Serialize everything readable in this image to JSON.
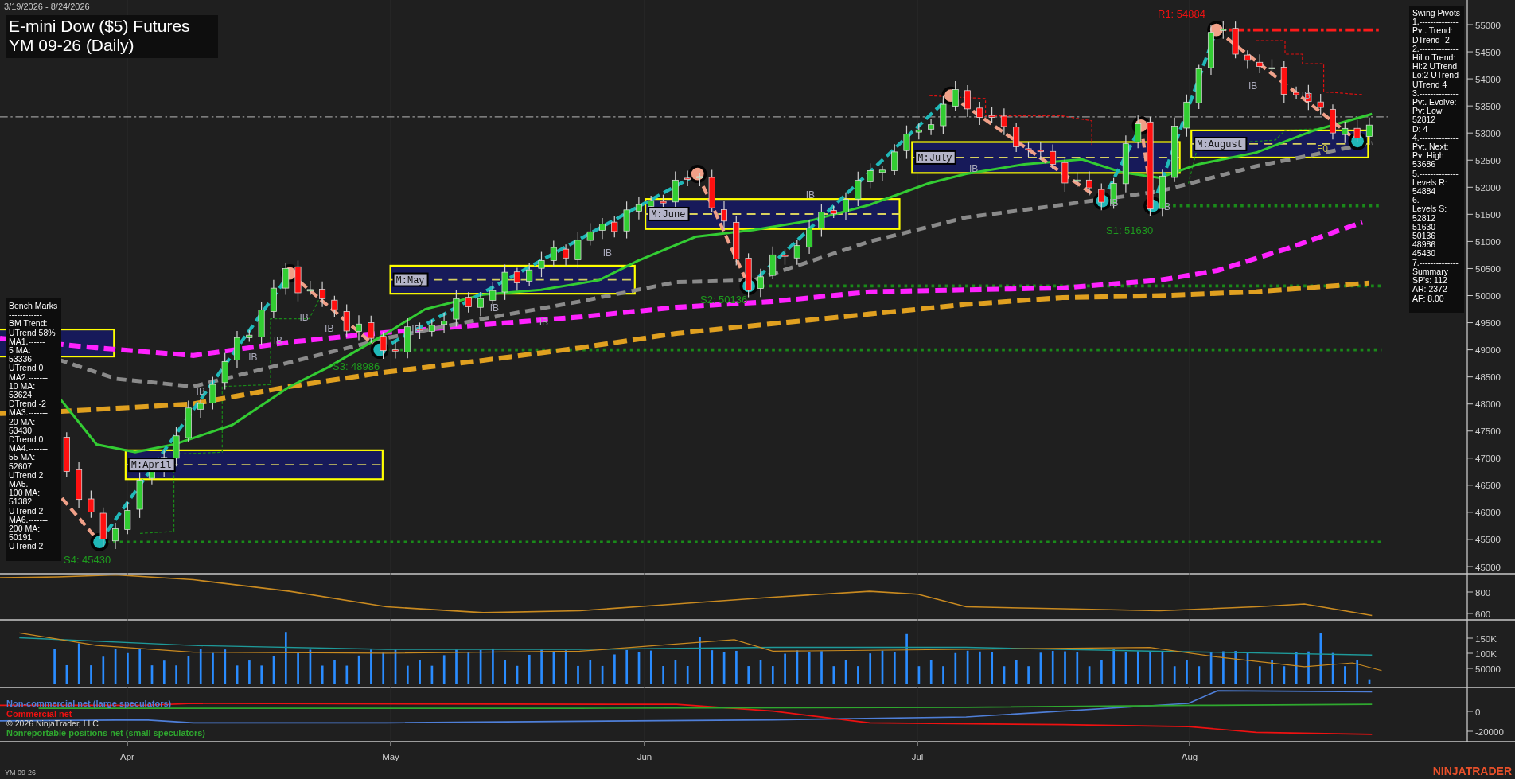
{
  "header": {
    "date_range": "3/19/2026 - 8/24/2026",
    "title": "E-mini Dow ($5) Futures",
    "subtitle": "YM 09-26 (Daily)"
  },
  "benchmarks_panel": {
    "lines": [
      "Bench Marks",
      "------------",
      "BM Trend:",
      "UTrend 58%",
      "MA1.------",
      "5 MA:",
      "53336",
      "UTrend 0",
      "MA2.-------",
      "10 MA:",
      "53624",
      "DTrend -2",
      "MA3.-------",
      "20 MA:",
      "53430",
      "DTrend 0",
      "MA4.-------",
      "55 MA:",
      "52607",
      "UTrend 2",
      "MA5.-------",
      "100 MA:",
      "51382",
      "UTrend 2",
      "MA6.-------",
      "200 MA:",
      "50191",
      "UTrend 2"
    ]
  },
  "swing_pivots_panel": {
    "lines": [
      "Swing Pivots",
      "1.--------------",
      "Pvt. Trend:",
      "DTrend -2",
      "2.--------------",
      "HiLo Trend:",
      "Hi:2 UTrend",
      "Lo:2 UTrend",
      "UTrend 4",
      "3.--------------",
      "Pvt. Evolve:",
      "Pvt Low",
      "52812",
      "D: 4",
      "4.--------------",
      "Pvt. Next:",
      "Pvt High",
      "53686",
      "5.--------------",
      "Levels R:",
      "54884",
      "6.--------------",
      "Levels S:",
      "52812",
      "51630",
      "50136",
      "48986",
      "45430",
      "7.--------------",
      "Summary",
      "SP's: 112",
      "AR: 2372",
      "AF: 8.00"
    ]
  },
  "price_chart": {
    "level_labels": [
      {
        "text": "R1: 54884",
        "kind": "resistance"
      },
      {
        "text": "S1: 51630",
        "kind": "support"
      },
      {
        "text": "S2: 50136",
        "kind": "support"
      },
      {
        "text": "S3: 48986",
        "kind": "support"
      },
      {
        "text": "S4: 45430",
        "kind": "support"
      }
    ],
    "month_boxes": [
      "M:April",
      "M:May",
      "M:June",
      "M:July",
      "M:August"
    ],
    "ib_labels": [
      "IB",
      "IB",
      "IB",
      "IB",
      "IB",
      "IB",
      "IB",
      "IB",
      "IB",
      "IB",
      "IB",
      "IB",
      "IB",
      "IB",
      "IB"
    ],
    "f0_label": "F0",
    "price_axis": [
      "55000",
      "54500",
      "54000",
      "53500",
      "53000",
      "52500",
      "52000",
      "51500",
      "51000",
      "50500",
      "50000",
      "49500",
      "49000",
      "48500",
      "48000",
      "47500",
      "47000",
      "46500",
      "46000",
      "45500",
      "45000"
    ]
  },
  "indicator_panel": {
    "axis": [
      "800",
      "600"
    ]
  },
  "volume_panel": {
    "axis": [
      "150K",
      "100K",
      "50000"
    ]
  },
  "cot_panel": {
    "legend": [
      {
        "text": "Non-commercial net (large speculators)",
        "color": "#4f7fd8"
      },
      {
        "text": "Commercial net",
        "color": "#ee1111"
      },
      {
        "text": "Nonreportable positions net (small speculators)",
        "color": "#2fa82f"
      }
    ],
    "copyright": "© 2026 NinjaTrader, LLC",
    "axis": [
      "0",
      "-20000"
    ]
  },
  "time_axis": [
    "Apr",
    "May",
    "Jun",
    "Jul",
    "Aug"
  ],
  "footer": {
    "instrument": "YM 09-26",
    "logo": "NINJATRADER"
  }
}
